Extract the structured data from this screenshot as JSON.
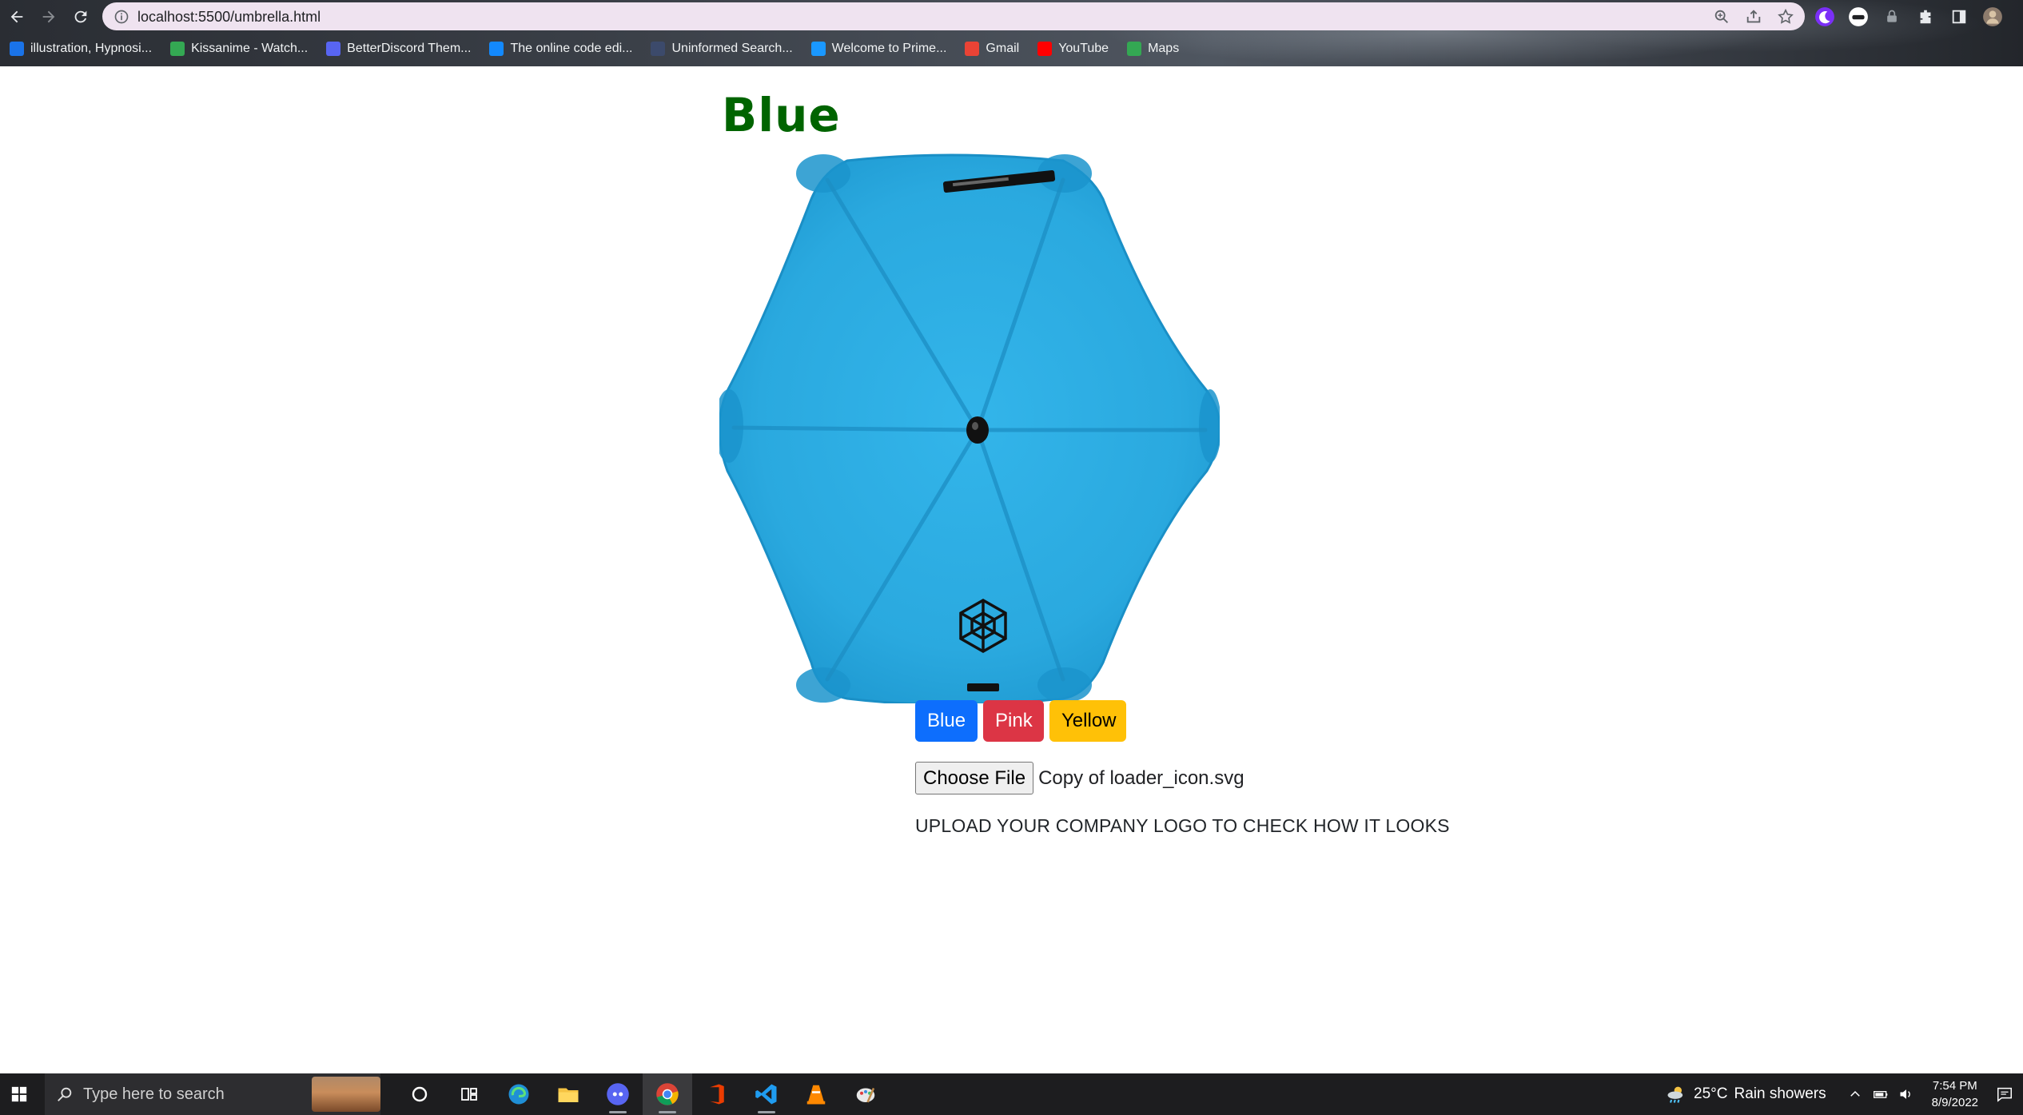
{
  "browser": {
    "url": "localhost:5500/umbrella.html",
    "bookmarks": [
      {
        "label": "illustration, Hypnosi...",
        "icon": "deviantart-icon",
        "color": "#1a73e8"
      },
      {
        "label": "Kissanime - Watch...",
        "icon": "tv-icon",
        "color": "#34a853"
      },
      {
        "label": "BetterDiscord Them...",
        "icon": "betterdiscord-icon",
        "color": "#5865f2"
      },
      {
        "label": "The online code edi...",
        "icon": "bolt-icon",
        "color": "#1389fd"
      },
      {
        "label": "Uninformed Search...",
        "icon": "gfg-icon",
        "color": "#3c4a6b"
      },
      {
        "label": "Welcome to Prime...",
        "icon": "prime-video-icon",
        "color": "#1a98ff"
      },
      {
        "label": "Gmail",
        "icon": "gmail-icon",
        "color": "#ea4335"
      },
      {
        "label": "YouTube",
        "icon": "youtube-icon",
        "color": "#ff0000"
      },
      {
        "label": "Maps",
        "icon": "maps-icon",
        "color": "#34a853"
      }
    ]
  },
  "page": {
    "title": "Blue",
    "buttons": {
      "blue": "Blue",
      "pink": "Pink",
      "yellow": "Yellow"
    },
    "file_input": {
      "button_label": "Choose File",
      "file_name": "Copy of loader_icon.svg"
    },
    "upload_text": "UPLOAD YOUR COMPANY LOGO TO CHECK HOW IT LOOKS",
    "umbrella_color": "#2eaee3"
  },
  "taskbar": {
    "search_placeholder": "Type here to search",
    "weather_temp": "25°C",
    "weather_text": "Rain showers",
    "time": "7:54 PM",
    "date": "8/9/2022"
  }
}
